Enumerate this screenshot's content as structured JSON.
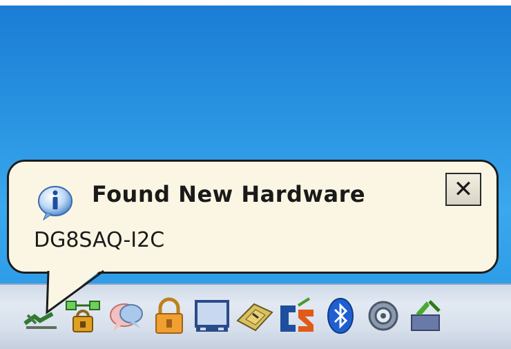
{
  "notification": {
    "title": "Found New Hardware",
    "message": "DG8SAQ-I2C",
    "icon": "info-icon",
    "close_label": "✕"
  },
  "tray": {
    "icons": [
      "network-cable-icon",
      "network-lock-icon",
      "messenger-icon",
      "security-lock-icon",
      "display-icon",
      "hardware-card-icon",
      "cs-app-icon",
      "bluetooth-icon",
      "audio-icon",
      "update-icon"
    ]
  },
  "colors": {
    "desktop": "#2a94e2",
    "balloon": "#fbf6e4",
    "taskbar": "#d6dfeb"
  }
}
